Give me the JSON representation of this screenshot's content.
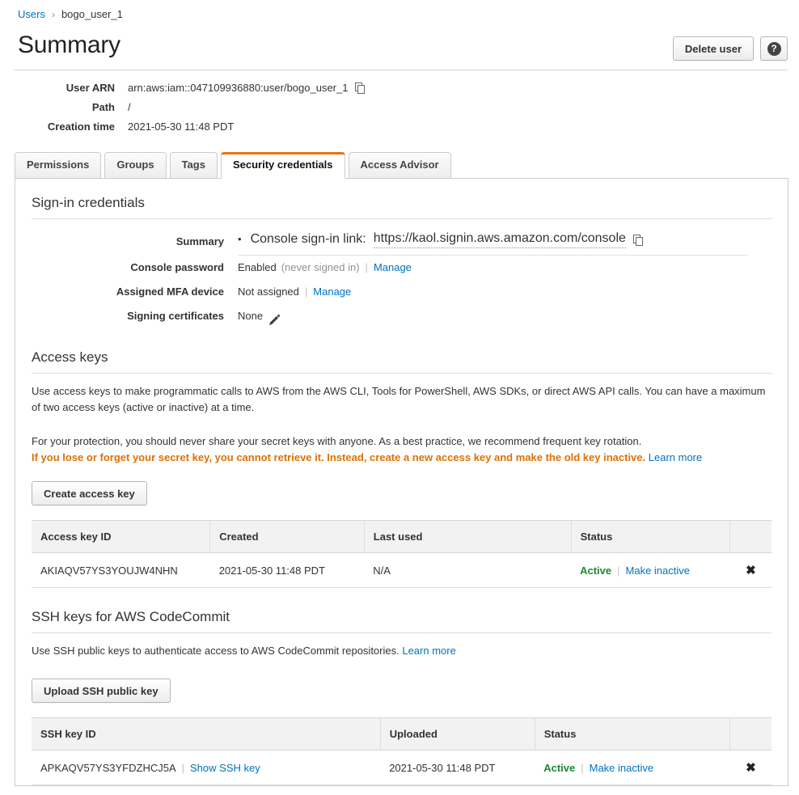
{
  "breadcrumb": {
    "parent": "Users",
    "separator": "›",
    "current": "bogo_user_1"
  },
  "header": {
    "title": "Summary",
    "delete_user_label": "Delete user",
    "help_label": "?"
  },
  "summary_details": [
    {
      "label": "User ARN",
      "value": "arn:aws:iam::047109936880:user/bogo_user_1",
      "copy": true
    },
    {
      "label": "Path",
      "value": "/",
      "copy": false
    },
    {
      "label": "Creation time",
      "value": "2021-05-30 11:48 PDT",
      "copy": false
    }
  ],
  "tabs": [
    {
      "label": "Permissions",
      "active": false
    },
    {
      "label": "Groups",
      "active": false
    },
    {
      "label": "Tags",
      "active": false
    },
    {
      "label": "Security credentials",
      "active": true
    },
    {
      "label": "Access Advisor",
      "active": false
    }
  ],
  "signin": {
    "section_title": "Sign-in credentials",
    "summary_label": "Summary",
    "summary_prefix": "Console sign-in link:",
    "summary_link": "https://kaol.signin.aws.amazon.com/console",
    "console_password_label": "Console password",
    "console_password_value": "Enabled",
    "console_password_note": "(never signed in)",
    "console_password_action": "Manage",
    "mfa_label": "Assigned MFA device",
    "mfa_value": "Not assigned",
    "mfa_action": "Manage",
    "signing_certs_label": "Signing certificates",
    "signing_certs_value": "None"
  },
  "access_keys": {
    "section_title": "Access keys",
    "paragraph1": "Use access keys to make programmatic calls to AWS from the AWS CLI, Tools for PowerShell, AWS SDKs, or direct AWS API calls. You can have a maximum of two access keys (active or inactive) at a time.",
    "paragraph2": "For your protection, you should never share your secret keys with anyone. As a best practice, we recommend frequent key rotation.",
    "warning": "If you lose or forget your secret key, you cannot retrieve it. Instead, create a new access key and make the old key inactive.",
    "learn_more": "Learn more",
    "create_button": "Create access key",
    "columns": [
      "Access key ID",
      "Created",
      "Last used",
      "Status",
      ""
    ],
    "rows": [
      {
        "key_id": "AKIAQV57YS3YOUJW4NHN",
        "created": "2021-05-30 11:48 PDT",
        "last_used": "N/A",
        "status": "Active",
        "status_action": "Make inactive",
        "delete": "✖"
      }
    ]
  },
  "ssh_keys": {
    "section_title": "SSH keys for AWS CodeCommit",
    "paragraph": "Use SSH public keys to authenticate access to AWS CodeCommit repositories.",
    "learn_more": "Learn more",
    "upload_button": "Upload SSH public key",
    "columns": [
      "SSH key ID",
      "Uploaded",
      "Status",
      ""
    ],
    "rows": [
      {
        "key_id": "APKAQV57YS3YFDZHCJ5A",
        "show_action": "Show SSH key",
        "uploaded": "2021-05-30 11:48 PDT",
        "status": "Active",
        "status_action": "Make inactive",
        "delete": "✖"
      }
    ]
  },
  "colors": {
    "link": "#0073bb",
    "warning": "#e07000",
    "active_status": "#1a8a2e",
    "tab_accent": "#ec7211"
  }
}
